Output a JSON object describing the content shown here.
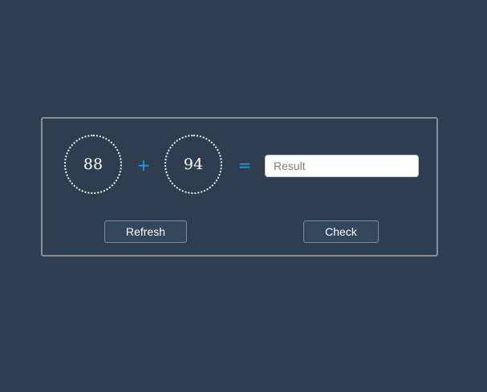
{
  "captcha": {
    "operand_a": "88",
    "operator": "+",
    "operand_b": "94",
    "equals": "=",
    "result_placeholder": "Result",
    "result_value": "",
    "refresh_label": "Refresh",
    "check_label": "Check"
  },
  "colors": {
    "background": "#2e3e50",
    "accent": "#1e9ee6",
    "panel_border": "#8a8f94",
    "button_bg": "#34485c"
  }
}
